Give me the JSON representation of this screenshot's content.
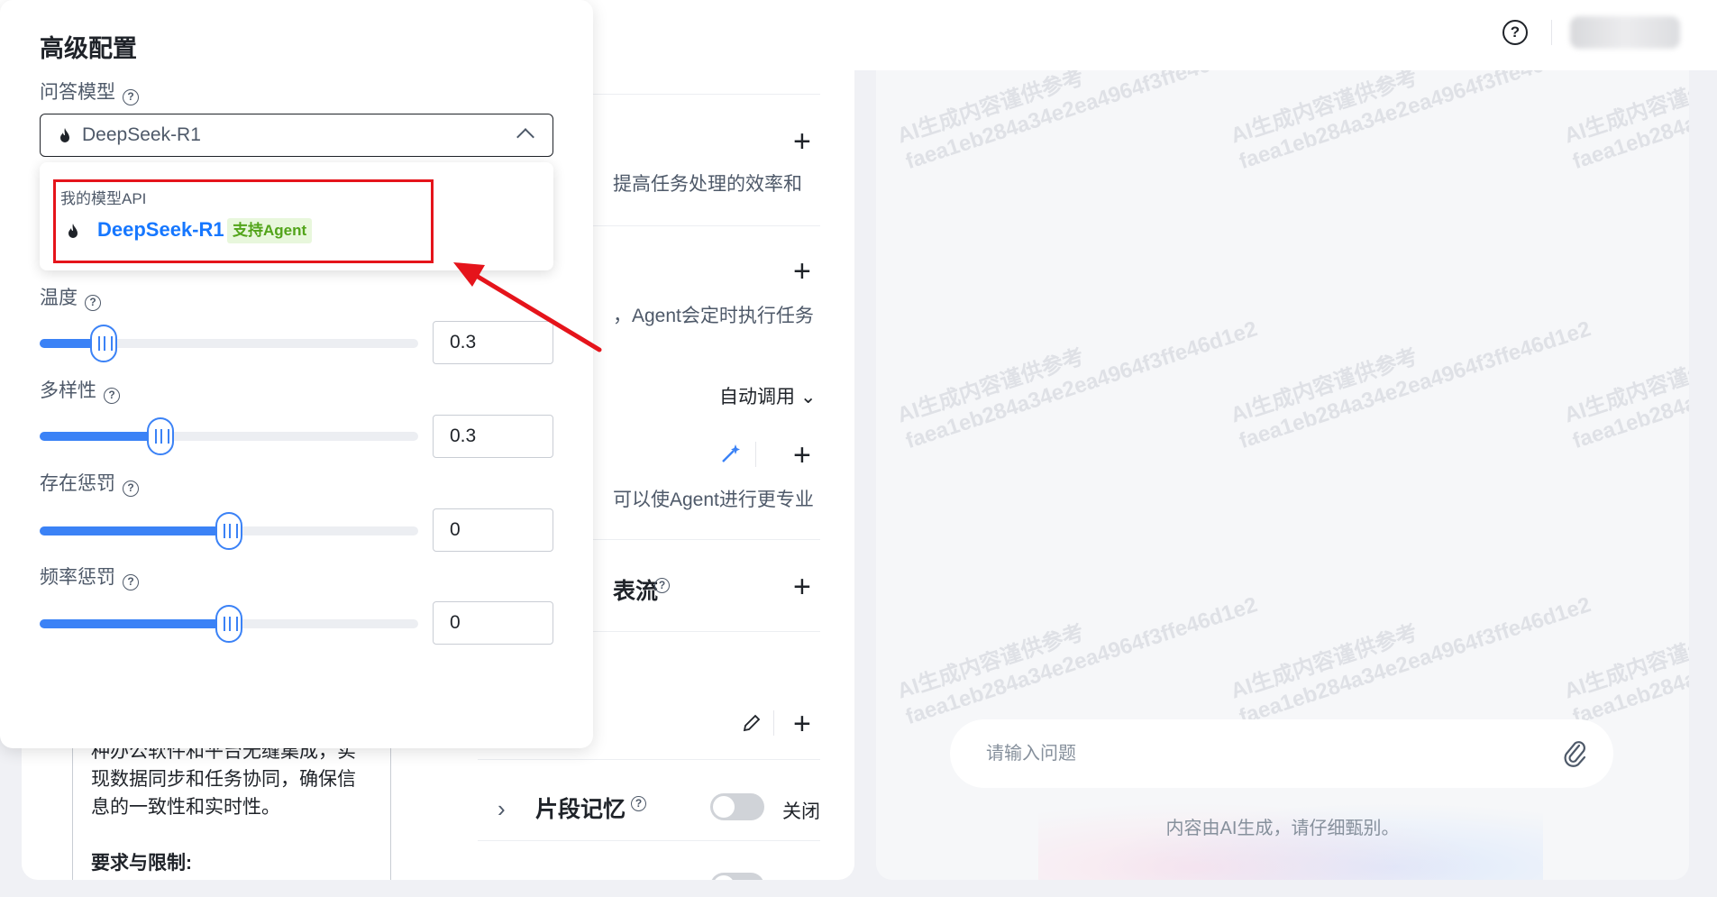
{
  "topbar": {
    "help_icon": "help-circle-icon"
  },
  "advanced": {
    "title": "高级配置",
    "model_label": "问答模型",
    "model_selected": "DeepSeek-R1",
    "dropdown": {
      "group_label": "我的模型API",
      "item_name": "DeepSeek-R1",
      "item_badge": "支持Agent"
    },
    "temperature": {
      "label": "温度",
      "value": "0.3",
      "level": 0.17
    },
    "diversity": {
      "label": "多样性",
      "value": "0.3",
      "level": 0.32
    },
    "presence_penalty": {
      "label": "存在惩罚",
      "value": "0",
      "level": 0.5
    },
    "frequency_penalty": {
      "label": "频率惩罚",
      "value": "0",
      "level": 0.5
    }
  },
  "config": {
    "row1_desc": "提高任务处理的效率和",
    "row2_desc": "，Agent会定时执行任务",
    "auto_call": "自动调用",
    "row4_desc": "可以使Agent进行更专业",
    "workflow_title": "表流",
    "memory_title": "片段记忆",
    "memory_toggle": "关闭"
  },
  "prompt": {
    "line1": "种办公软件和平台无缝集成，实",
    "line2": "现数据同步和任务协同，确保信",
    "line3": "息的一致性和实时性。",
    "line4": "要求与限制:"
  },
  "preview": {
    "watermark_line1": "AI生成内容谨供参考",
    "watermark_line2": "faea1eb284a34e2ea4964f3ffe46d1e2",
    "input_placeholder": "请输入问题",
    "disclaimer": "内容由AI生成，请仔细甄别。"
  },
  "colors": {
    "accent": "#3b82f6",
    "link": "#1677ff",
    "highlight": "#e5141b",
    "badge_bg": "#e8f7dc",
    "badge_text": "#52a41a"
  }
}
